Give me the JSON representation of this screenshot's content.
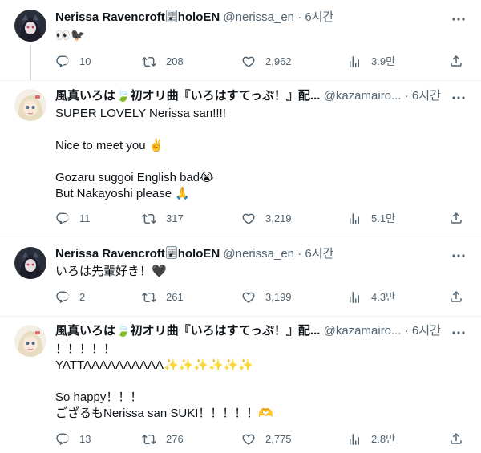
{
  "tweets": [
    {
      "name": "Nerissa Ravencroft",
      "name_suffix": "holoEN",
      "handle": "@nerissa_en",
      "dot": "·",
      "time": "6시간",
      "text": "👀🐦‍⬛",
      "replies": "10",
      "retweets": "208",
      "likes": "2,962",
      "views": "3.9만"
    },
    {
      "name": "風真いろは🍃初オリ曲『いろはすてっぷ！』配...",
      "handle": "@kazamairo...",
      "dot": "·",
      "time": "6시간",
      "text": "SUPER LOVELY Nerissa san!!!!\n\nNice to meet you ✌️\n\nGozaru suggoi English bad😭\nBut Nakayoshi please 🙏",
      "replies": "11",
      "retweets": "317",
      "likes": "3,219",
      "views": "5.1만"
    },
    {
      "name": "Nerissa Ravencroft",
      "name_suffix": "holoEN",
      "handle": "@nerissa_en",
      "dot": "·",
      "time": "6시간",
      "text": "いろは先輩好き！🖤",
      "replies": "2",
      "retweets": "261",
      "likes": "3,199",
      "views": "4.3만"
    },
    {
      "name": "風真いろは🍃初オリ曲『いろはすてっぷ！』配...",
      "handle": "@kazamairo...",
      "dot": "·",
      "time": "6시간",
      "text": "！！！！！\nYATTAAAAAAAAAA✨✨✨✨✨✨\n\nSo happy！！！\nござるもNerissa san SUKI！！！！！🫶",
      "replies": "13",
      "retweets": "276",
      "likes": "2,775",
      "views": "2.8만"
    }
  ],
  "icons": {
    "reply": "reply-icon",
    "retweet": "retweet-icon",
    "like": "like-icon",
    "views": "views-icon",
    "share": "share-icon",
    "more": "more-icon",
    "music": "music-note-icon"
  },
  "colors": {
    "text": "#0f1419",
    "secondary": "#536471",
    "divider": "#eff3f4",
    "thread_line": "#cfd9de"
  }
}
